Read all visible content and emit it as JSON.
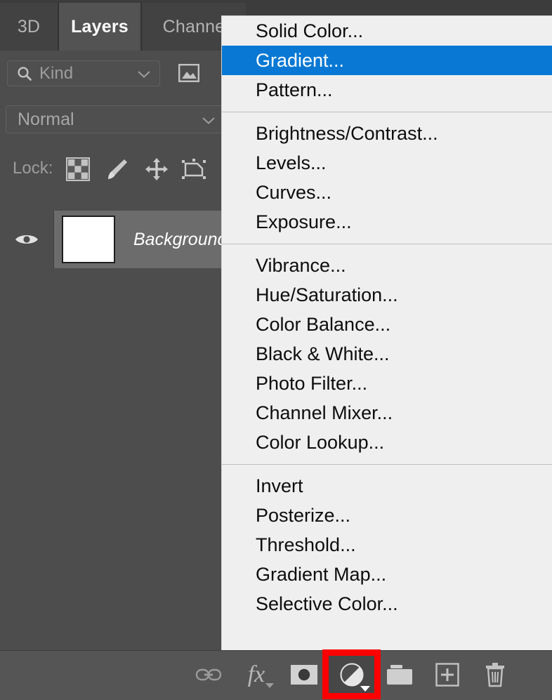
{
  "panel": {
    "tabs": [
      {
        "label": "3D",
        "active": false
      },
      {
        "label": "Layers",
        "active": true
      },
      {
        "label": "Channe",
        "active": false
      }
    ],
    "filter": {
      "search_icon": "search-icon",
      "kind_label": "Kind",
      "caret_icon": "chevron-down-icon",
      "image_filter_icon": "image-filter-icon"
    },
    "blend": {
      "mode": "Normal",
      "caret_icon": "chevron-down-icon"
    },
    "lock": {
      "label": "Lock:",
      "icons": [
        "lock-transparency-checkerboard-icon",
        "lock-image-pixels-brush-icon",
        "lock-position-move-icon",
        "lock-artboard-nesting-icon"
      ]
    },
    "layers": [
      {
        "name": "Background",
        "visible": true,
        "selected": true,
        "eye_icon": "eye-icon",
        "thumbnail_color": "#ffffff"
      }
    ],
    "bottom_bar": [
      {
        "name": "link-layers-button",
        "icon": "link-icon"
      },
      {
        "name": "layer-style-button",
        "icon": "fx-icon",
        "label": "fx"
      },
      {
        "name": "add-layer-mask-button",
        "icon": "layer-mask-icon"
      },
      {
        "name": "new-adjustment-layer-button",
        "icon": "half-filled-circle-icon",
        "active": true
      },
      {
        "name": "new-group-button",
        "icon": "folder-icon"
      },
      {
        "name": "new-layer-button",
        "icon": "plus-square-icon"
      },
      {
        "name": "delete-layer-button",
        "icon": "trash-icon"
      }
    ]
  },
  "menu": {
    "name": "new-adjustment-layer-menu",
    "highlight_color": "#0878d4",
    "background_color": "#efefef",
    "groups": [
      {
        "items": [
          {
            "label": "Solid Color...",
            "selected": false
          },
          {
            "label": "Gradient...",
            "selected": true
          },
          {
            "label": "Pattern...",
            "selected": false
          }
        ]
      },
      {
        "items": [
          {
            "label": "Brightness/Contrast...",
            "selected": false
          },
          {
            "label": "Levels...",
            "selected": false
          },
          {
            "label": "Curves...",
            "selected": false
          },
          {
            "label": "Exposure...",
            "selected": false
          }
        ]
      },
      {
        "items": [
          {
            "label": "Vibrance...",
            "selected": false
          },
          {
            "label": "Hue/Saturation...",
            "selected": false
          },
          {
            "label": "Color Balance...",
            "selected": false
          },
          {
            "label": "Black & White...",
            "selected": false
          },
          {
            "label": "Photo Filter...",
            "selected": false
          },
          {
            "label": "Channel Mixer...",
            "selected": false
          },
          {
            "label": "Color Lookup...",
            "selected": false
          }
        ]
      },
      {
        "items": [
          {
            "label": "Invert",
            "selected": false
          },
          {
            "label": "Posterize...",
            "selected": false
          },
          {
            "label": "Threshold...",
            "selected": false
          },
          {
            "label": "Gradient Map...",
            "selected": false
          },
          {
            "label": "Selective Color...",
            "selected": false
          }
        ]
      }
    ]
  },
  "annotation": {
    "name": "red-highlight-box",
    "color": "#ff0000",
    "target": "new-adjustment-layer-button"
  }
}
